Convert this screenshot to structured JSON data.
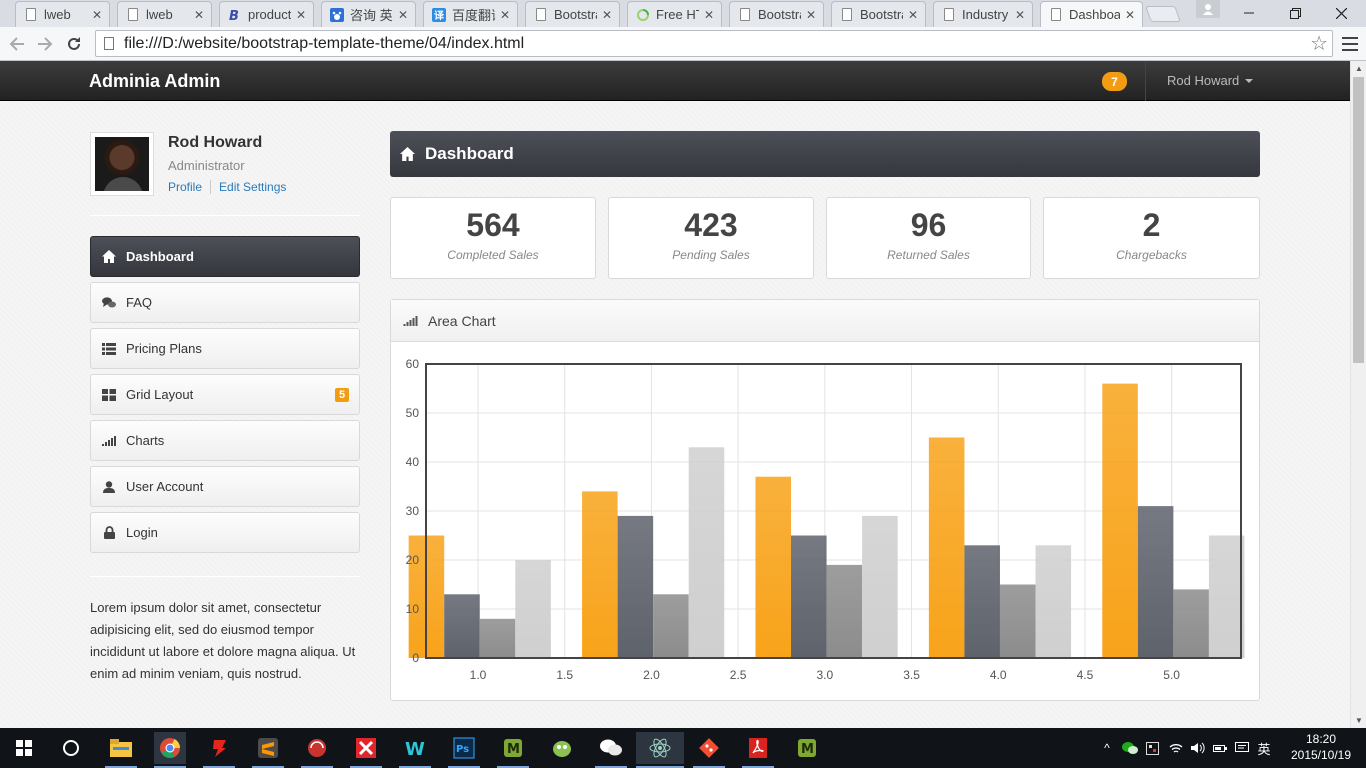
{
  "browser": {
    "tabs": [
      {
        "title": "lweb",
        "favicon": "doc-icon"
      },
      {
        "title": "lweb",
        "favicon": "doc-icon"
      },
      {
        "title": "product,",
        "favicon": "bootstrap-icon"
      },
      {
        "title": "咨询 英语",
        "favicon": "paw-icon"
      },
      {
        "title": "百度翻译",
        "favicon": "translate-icon"
      },
      {
        "title": "Bootstra",
        "favicon": "doc-icon"
      },
      {
        "title": "Free HTI",
        "favicon": "loading-icon"
      },
      {
        "title": "Bootstra",
        "favicon": "doc-icon"
      },
      {
        "title": "Bootstra",
        "favicon": "doc-icon"
      },
      {
        "title": "Industry",
        "favicon": "doc-icon"
      },
      {
        "title": "Dashboa",
        "favicon": "doc-icon",
        "active": true
      }
    ],
    "url": "file:///D:/website/bootstrap-template-theme/04/index.html"
  },
  "navbar": {
    "brand": "Adminia Admin",
    "notifications": "7",
    "user": "Rod Howard"
  },
  "profile": {
    "name": "Rod Howard",
    "role": "Administrator",
    "link_profile": "Profile",
    "link_settings": "Edit Settings"
  },
  "sidebar": {
    "items": [
      {
        "label": "Dashboard",
        "icon": "home-icon",
        "active": true
      },
      {
        "label": "FAQ",
        "icon": "comments-icon"
      },
      {
        "label": "Pricing Plans",
        "icon": "list-icon"
      },
      {
        "label": "Grid Layout",
        "icon": "grid-icon",
        "badge": "5"
      },
      {
        "label": "Charts",
        "icon": "signal-icon"
      },
      {
        "label": "User Account",
        "icon": "user-icon"
      },
      {
        "label": "Login",
        "icon": "lock-icon"
      }
    ],
    "text": "Lorem ipsum dolor sit amet, consectetur adipisicing elit, sed do eiusmod tempor incididunt ut labore et dolore magna aliqua. Ut enim ad minim veniam, quis nostrud."
  },
  "page": {
    "title": "Dashboard"
  },
  "stats": [
    {
      "value": "564",
      "label": "Completed Sales"
    },
    {
      "value": "423",
      "label": "Pending Sales"
    },
    {
      "value": "96",
      "label": "Returned Sales"
    },
    {
      "value": "2",
      "label": "Chargebacks"
    }
  ],
  "chart_panel": {
    "title": "Area Chart"
  },
  "chart_data": {
    "type": "bar",
    "title": "",
    "xlabel": "",
    "ylabel": "",
    "xlim": [
      0.7,
      5.4
    ],
    "ylim": [
      0,
      60
    ],
    "x_ticks": [
      1.0,
      1.5,
      2.0,
      2.5,
      3.0,
      3.5,
      4.0,
      4.5,
      5.0
    ],
    "y_ticks": [
      0,
      10,
      20,
      30,
      40,
      50,
      60
    ],
    "grid": true,
    "categories": [
      1,
      2,
      3,
      4,
      5
    ],
    "series": [
      {
        "values": [
          25,
          34,
          37,
          45,
          56
        ],
        "color": "#f8a31a"
      },
      {
        "values": [
          13,
          29,
          25,
          23,
          31
        ],
        "color": "#5e626b"
      },
      {
        "values": [
          8,
          13,
          19,
          15,
          14
        ],
        "color": "#8c8c8c"
      },
      {
        "values": [
          20,
          43,
          29,
          23,
          25
        ],
        "color": "#cfcfcf"
      }
    ]
  },
  "taskbar": {
    "apps": [
      "windows-start-icon",
      "search-circle-icon",
      "file-explorer-icon",
      "chrome-icon",
      "app-icon",
      "sublime-icon",
      "app-icon",
      "xmind-icon",
      "webstorm-icon",
      "photoshop-icon",
      "app-icon",
      "app-icon",
      "wechat-icon",
      "atom-icon",
      "git-icon",
      "acrobat-icon",
      "app-icon"
    ],
    "ime": "英",
    "time": "18:20",
    "date": "2015/10/19"
  }
}
